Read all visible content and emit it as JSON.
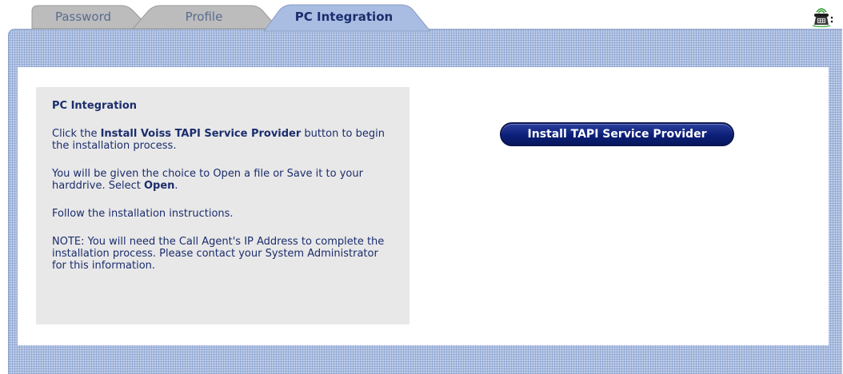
{
  "tabs": [
    {
      "label": "Password",
      "active": false
    },
    {
      "label": "Profile",
      "active": false
    },
    {
      "label": "PC Integration",
      "active": true
    }
  ],
  "icons": {
    "top_right": "phone-status-icon"
  },
  "colors": {
    "panel_background": "#a9bde2",
    "text_navy": "#1b2d6d",
    "button_navy": "#0c1f78",
    "instructions_background": "#e8e8e8",
    "tab_background": "#bcbcbc"
  },
  "instructions": {
    "heading": "PC Integration",
    "p1_prefix": "Click the ",
    "p1_bold": "Install Voiss TAPI Service Provider",
    "p1_suffix": " button to begin the installation process.",
    "p2_prefix": "You will be given the choice to Open a file or Save it to your harddrive. Select ",
    "p2_bold": "Open",
    "p2_suffix": ".",
    "p3": "Follow the installation instructions.",
    "p4": "NOTE: You will need the Call Agent's IP Address to complete the installation process. Please contact your System Administrator for this information."
  },
  "install_button": {
    "label": "Install TAPI Service Provider"
  }
}
